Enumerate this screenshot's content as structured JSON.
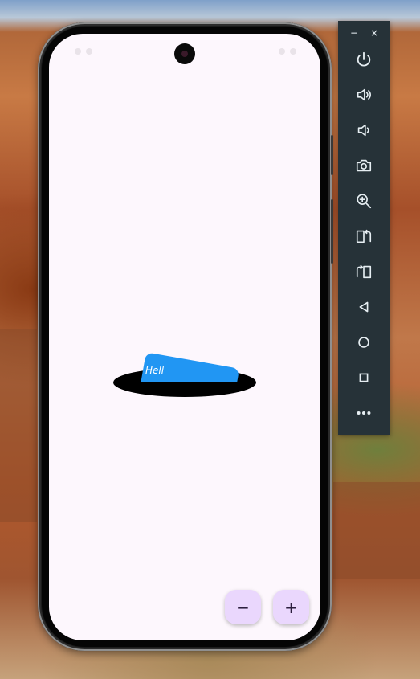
{
  "emulator": {
    "toolbar": {
      "minimize_glyph": "−",
      "close_glyph": "×",
      "items": [
        {
          "name": "power-icon"
        },
        {
          "name": "volume-up-icon"
        },
        {
          "name": "volume-down-icon"
        },
        {
          "name": "camera-icon"
        },
        {
          "name": "zoom-in-icon"
        },
        {
          "name": "rotate-left-icon"
        },
        {
          "name": "rotate-right-icon"
        },
        {
          "name": "back-icon"
        },
        {
          "name": "home-icon"
        },
        {
          "name": "overview-icon"
        },
        {
          "name": "more-icon"
        }
      ]
    }
  },
  "app": {
    "card_text": "Hell",
    "fab_minus": "−",
    "fab_plus": "+",
    "colors": {
      "background": "#fdf7fd",
      "card": "#2196f3",
      "hole": "#000000",
      "fab": "#ead7fd",
      "toolbar": "#263238"
    }
  }
}
